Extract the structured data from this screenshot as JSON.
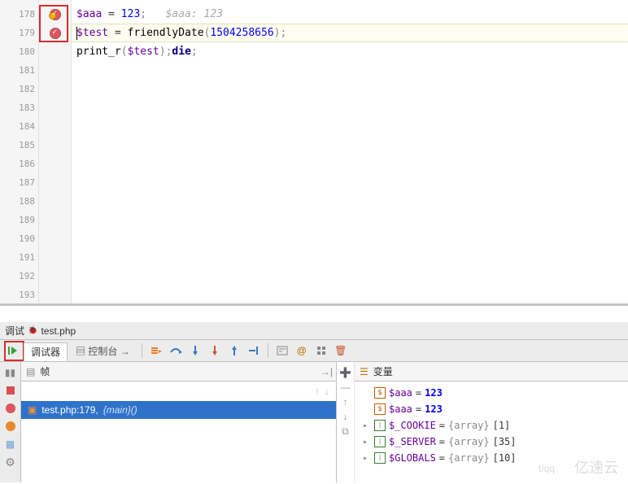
{
  "editor": {
    "line_numbers": [
      "178",
      "179",
      "180",
      "181",
      "182",
      "183",
      "184",
      "185",
      "186",
      "187",
      "188",
      "189",
      "190",
      "191",
      "192",
      "193"
    ],
    "breakpoints": [
      178,
      179
    ],
    "current_line": 179,
    "lines": {
      "l178_var": "$aaa",
      "l178_eq": " = ",
      "l178_num": "123",
      "l178_sc": ";",
      "l178_hint": "   $aaa: 123",
      "l179_var": "$test",
      "l179_eq": " = ",
      "l179_fn": "friendlyDate",
      "l179_lp": "(",
      "l179_arg": "1504258656",
      "l179_rp": ")",
      "l179_sc": ";",
      "l180_fn": "print_r",
      "l180_lp": "(",
      "l180_arg": "$test",
      "l180_rp": ")",
      "l180_sc1": ";",
      "l180_kw": "die",
      "l180_sc2": ";"
    }
  },
  "debug_tab": {
    "label_prefix": "调试 ",
    "file": "test.php"
  },
  "toolbar": {
    "debugger_tab": "调试器",
    "console_tab": "控制台"
  },
  "frames": {
    "header": "帧",
    "row_file": "test.php:179, ",
    "row_fn": "{main}()"
  },
  "vars": {
    "header": "变量",
    "rows": [
      {
        "kind": "scalar",
        "name": "$aaa",
        "eq": " = ",
        "value": "123"
      },
      {
        "kind": "scalar",
        "name": "$aaa",
        "eq": " = ",
        "value": "123"
      },
      {
        "kind": "array",
        "name": "$_COOKIE",
        "eq": " = ",
        "type": "{array}",
        "count": " [1]"
      },
      {
        "kind": "array",
        "name": "$_SERVER",
        "eq": " = ",
        "type": "{array}",
        "count": " [35]"
      },
      {
        "kind": "array",
        "name": "$GLOBALS",
        "eq": " = ",
        "type": "{array}",
        "count": " [10]"
      }
    ]
  },
  "watermark": "亿速云",
  "watermark2": "t/qq"
}
